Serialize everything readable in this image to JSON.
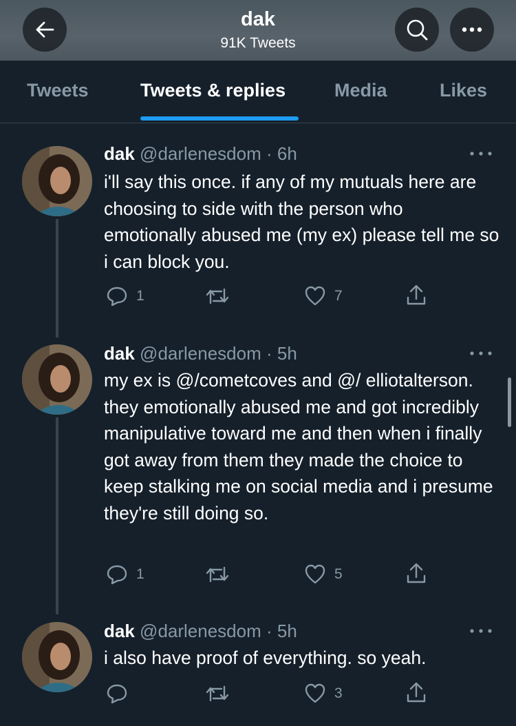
{
  "header": {
    "title": "dak",
    "count": "91K Tweets",
    "back_icon": "arrow-left-icon",
    "search_icon": "search-icon",
    "more_icon": "more-horizontal-icon"
  },
  "tabs": [
    {
      "label": "Tweets",
      "active": false
    },
    {
      "label": "Tweets & replies",
      "active": true
    },
    {
      "label": "Media",
      "active": false
    },
    {
      "label": "Likes",
      "active": false
    }
  ],
  "colors": {
    "background": "#15202b",
    "accent": "#1d9bf0",
    "secondary_text": "#8899a6",
    "divider": "#38444d"
  },
  "tweets": [
    {
      "name": "dak",
      "handle": "@darlenesdom",
      "time": "· 6h",
      "text": "i'll say this once. if any of my mutuals here are choosing to side with the person who emotionally abused me (my ex) please tell me so i can block you.",
      "replies": "1",
      "retweets": "",
      "likes": "7"
    },
    {
      "name": "dak",
      "handle": "@darlenesdom",
      "time": "· 5h",
      "text": "my ex is @/cometcoves and @/ elliotalterson. they emotionally abused me and got incredibly manipulative toward me and then when i finally got away from them they made the choice to keep stalking me on social media and i presume they're still doing so.",
      "replies": "1",
      "retweets": "",
      "likes": "5"
    },
    {
      "name": "dak",
      "handle": "@darlenesdom",
      "time": "· 5h",
      "text": "i also have proof of everything. so yeah.",
      "replies": "",
      "retweets": "",
      "likes": "3"
    }
  ]
}
